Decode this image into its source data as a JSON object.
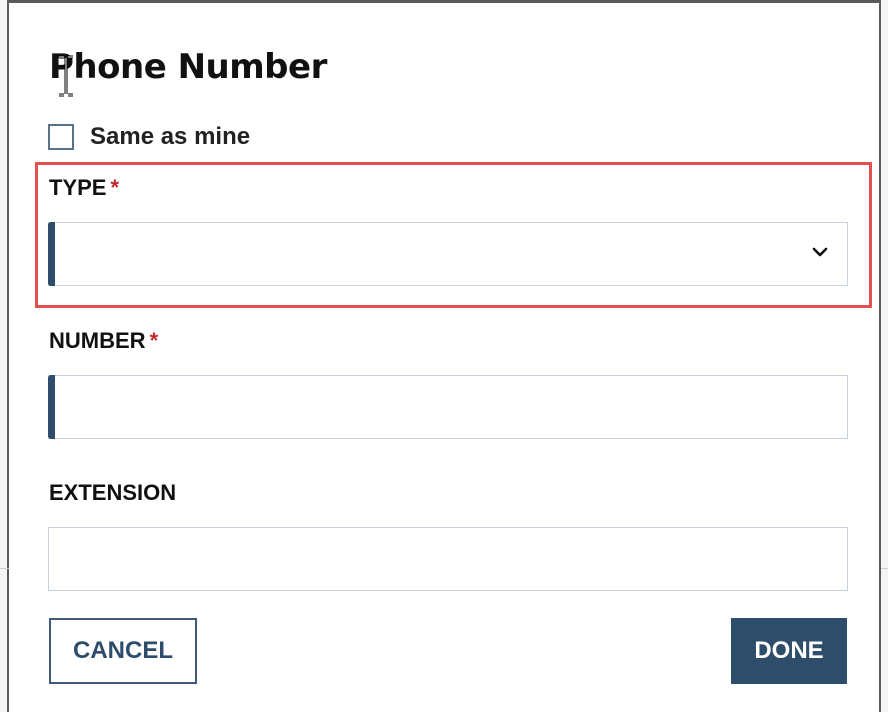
{
  "dialog": {
    "title": "Phone Number",
    "same_as_mine": {
      "label": "Same as mine",
      "checked": false
    },
    "fields": {
      "type": {
        "label": "TYPE",
        "required_mark": "*",
        "value": ""
      },
      "number": {
        "label": "NUMBER",
        "required_mark": "*",
        "value": ""
      },
      "extension": {
        "label": "EXTENSION",
        "value": ""
      }
    },
    "buttons": {
      "cancel": "CANCEL",
      "done": "DONE"
    }
  },
  "colors": {
    "accent": "#2e4d6b",
    "required": "#c0282d",
    "highlight": "#e25050"
  },
  "icons": {
    "type_dropdown": "chevron-down-icon",
    "cursor": "text-cursor-icon"
  }
}
